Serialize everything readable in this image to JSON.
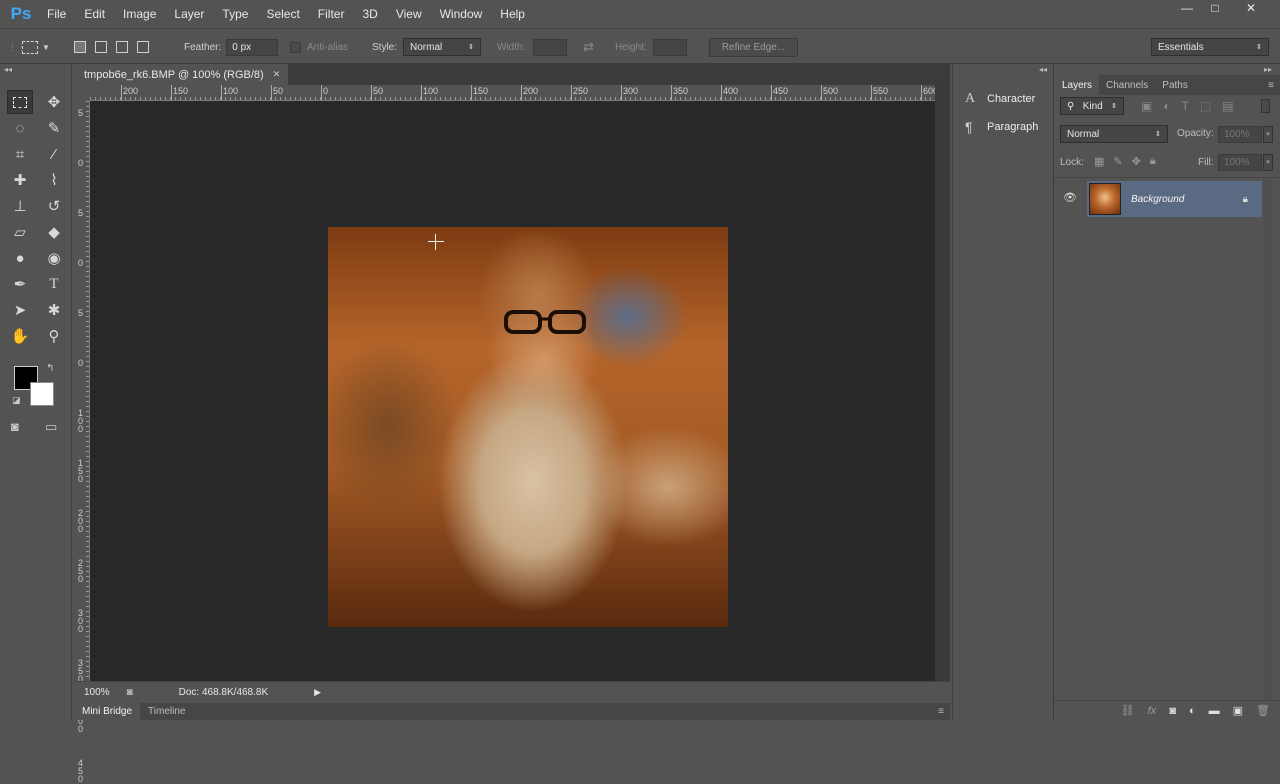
{
  "app": {
    "logo": "Ps"
  },
  "menu": [
    "File",
    "Edit",
    "Image",
    "Layer",
    "Type",
    "Select",
    "Filter",
    "3D",
    "View",
    "Window",
    "Help"
  ],
  "window_controls": {
    "minimize": "—",
    "maximize": "□",
    "close": "✕"
  },
  "options": {
    "feather_label": "Feather:",
    "feather_value": "0 px",
    "antialias_label": "Anti-alias",
    "style_label": "Style:",
    "style_value": "Normal",
    "width_label": "Width:",
    "height_label": "Height:",
    "refine_edge_label": "Refine Edge...",
    "workspace_value": "Essentials"
  },
  "document": {
    "tab_title": "tmpob6e_rk6.BMP @ 100% (RGB/8)",
    "ruler_h_ticks": [
      "200",
      "150",
      "100",
      "50",
      "0",
      "50",
      "100",
      "150",
      "200",
      "250",
      "300",
      "350",
      "400",
      "450",
      "500",
      "550",
      "600"
    ],
    "ruler_v_ticks": [
      "5",
      "0",
      "5",
      "0",
      "5",
      "0",
      "1 0 0",
      "1 5 0",
      "2 0 0",
      "2 5 0",
      "3 0 0",
      "3 5 0",
      "4 0 0",
      "4 5 0"
    ],
    "zoom": "100%",
    "doc_info": "Doc: 468.8K/468.8K"
  },
  "bottom_tabs": [
    "Mini Bridge",
    "Timeline"
  ],
  "mid_panel": {
    "character_label": "Character",
    "paragraph_label": "Paragraph"
  },
  "layers_panel": {
    "tabs": [
      "Layers",
      "Channels",
      "Paths"
    ],
    "kind_label": "Kind",
    "blend_mode": "Normal",
    "opacity_label": "Opacity:",
    "opacity_value": "100%",
    "lock_label": "Lock:",
    "fill_label": "Fill:",
    "fill_value": "100%",
    "layer_name": "Background"
  },
  "colors": {
    "foreground": "#000000",
    "background": "#ffffff",
    "selected_layer": "#5b6a83"
  }
}
